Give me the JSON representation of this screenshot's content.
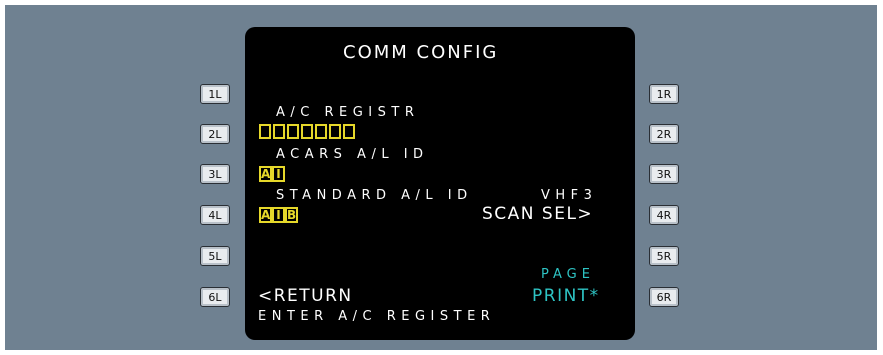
{
  "colors": {
    "bezel": "#6f8191",
    "screen": "#000000",
    "white": "#ffffff",
    "cyan": "#2ec4c4",
    "amber": "#e6d82a"
  },
  "lsk": {
    "left": [
      "1L",
      "2L",
      "3L",
      "4L",
      "5L",
      "6L"
    ],
    "right": [
      "1R",
      "2R",
      "3R",
      "4R",
      "5R",
      "6R"
    ]
  },
  "mcdu": {
    "title": "COMM CONFIG",
    "ac_registr_label": "A/C REGISTR",
    "ac_registr_entry_count": 7,
    "acars_label": "ACARS A/L ID",
    "acars_value": [
      "A",
      "I"
    ],
    "standard_label": "STANDARD A/L ID",
    "vhf3_label": "VHF3",
    "standard_value": [
      "A",
      "I",
      "B"
    ],
    "scan_sel": "SCAN SEL>",
    "page_label": "PAGE",
    "return_label": "<RETURN",
    "print_label": "PRINT*",
    "scratchpad": "ENTER A/C REGISTER"
  }
}
